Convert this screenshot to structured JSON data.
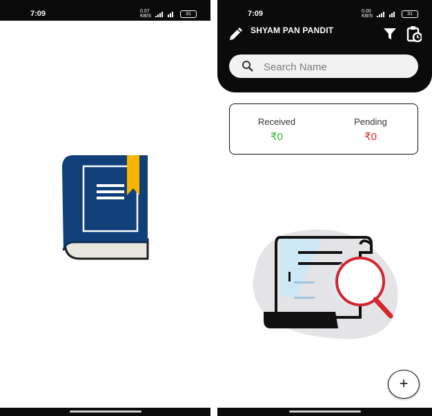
{
  "left_screen": {
    "status_bar": {
      "time": "7:09",
      "net_speed": "0.07\nKB/S",
      "battery": "31"
    }
  },
  "right_screen": {
    "status_bar": {
      "time": "7:09",
      "net_speed": "0.00\nKB/S",
      "battery": "31"
    },
    "header": {
      "user_name": "SHYAM PAN PANDIT"
    },
    "search": {
      "placeholder": "Search Name",
      "value": ""
    },
    "summary": {
      "received_label": "Received",
      "received_value": "₹0",
      "pending_label": "Pending",
      "pending_value": "₹0"
    },
    "fab_label": "+"
  },
  "icons": [
    "book-icon",
    "edit-icon",
    "filter-icon",
    "clipboard-clock-icon",
    "search-icon",
    "document-search-illustration"
  ],
  "colors": {
    "header_bg": "#0b0b0b",
    "received": "#2db82d",
    "pending": "#e02424",
    "book_cover": "#113f7a",
    "bookmark": "#f7b500"
  }
}
